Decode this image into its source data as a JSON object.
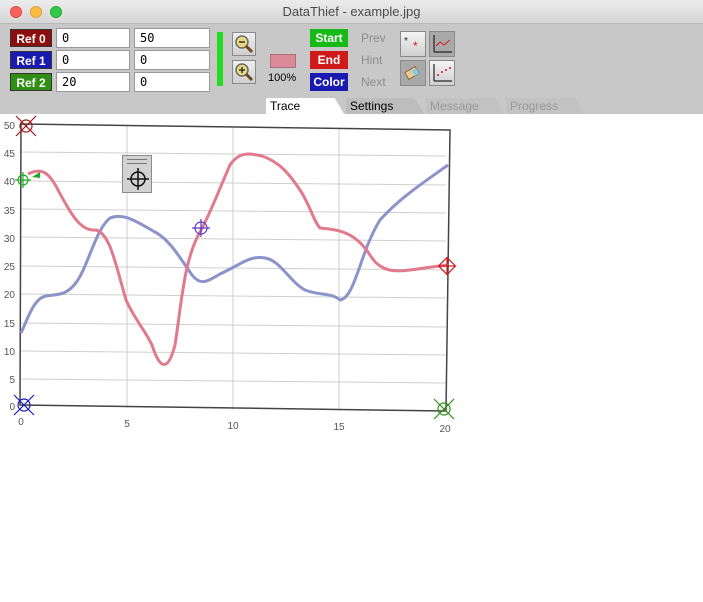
{
  "window": {
    "title": "DataThief - example.jpg"
  },
  "refs": [
    {
      "label": "Ref 0",
      "x": "0",
      "y": "50",
      "color": "#8b0f0f"
    },
    {
      "label": "Ref 1",
      "x": "0",
      "y": "0",
      "color": "#1a1ab0"
    },
    {
      "label": "Ref 2",
      "x": "20",
      "y": "0",
      "color": "#2f8f14"
    }
  ],
  "zoom": {
    "in_icon": "zoom-out-icon",
    "out_icon": "zoom-in-icon",
    "level": "100%",
    "color_swatch": "#dd8a98"
  },
  "actions": {
    "start": "Start",
    "end": "End",
    "color": "Color",
    "start_color": "#16b916",
    "end_color": "#d01a1a",
    "color_color": "#1a1ab0"
  },
  "nav": {
    "prev": "Prev",
    "hint": "Hint",
    "next": "Next"
  },
  "tabs": [
    {
      "label": "Trace",
      "state": "active"
    },
    {
      "label": "Settings",
      "state": "inactive"
    },
    {
      "label": "Message",
      "state": "disabled"
    },
    {
      "label": "Progress",
      "state": "disabled"
    }
  ],
  "plot": {
    "y_ticks": [
      "50",
      "45",
      "40",
      "35",
      "30",
      "25",
      "20",
      "15",
      "10",
      "5",
      "0"
    ],
    "x_ticks": [
      "0",
      "5",
      "10",
      "15",
      "20"
    ],
    "pink_color": "#e07a8c",
    "blue_color": "#8b93c9"
  }
}
